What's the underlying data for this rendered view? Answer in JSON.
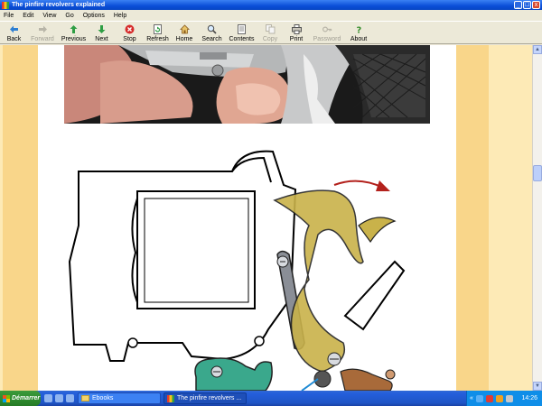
{
  "window": {
    "title": "The pinfire revolvers explained",
    "controls": [
      "_",
      "□",
      "x"
    ]
  },
  "menu": [
    "File",
    "Edit",
    "View",
    "Go",
    "Options",
    "Help"
  ],
  "toolbar": [
    {
      "label": "Back",
      "icon": "back-arrow-icon",
      "enabled": true
    },
    {
      "label": "Forward",
      "icon": "forward-arrow-icon",
      "enabled": false
    },
    {
      "label": "Previous",
      "icon": "up-arrow-icon",
      "enabled": true
    },
    {
      "label": "Next",
      "icon": "down-arrow-icon",
      "enabled": true
    },
    {
      "label": "Stop",
      "icon": "stop-icon",
      "enabled": true
    },
    {
      "label": "Refresh",
      "icon": "refresh-icon",
      "enabled": true
    },
    {
      "label": "Home",
      "icon": "home-icon",
      "enabled": true
    },
    {
      "label": "Search",
      "icon": "search-icon",
      "enabled": true
    },
    {
      "label": "Contents",
      "icon": "contents-icon",
      "enabled": true
    },
    {
      "label": "Copy",
      "icon": "copy-icon",
      "enabled": false
    },
    {
      "label": "Print",
      "icon": "print-icon",
      "enabled": true
    },
    {
      "label": "Password",
      "icon": "key-icon",
      "enabled": false
    },
    {
      "label": "About",
      "icon": "help-icon",
      "enabled": true
    }
  ],
  "colors": {
    "page_margin": "#fdeab6",
    "side_bar": "#f9d68a",
    "hammer": "#c9b24a",
    "trigger_part": "#3aa88c",
    "sear_part": "#a86a3a",
    "arrow": "#b3211c"
  },
  "taskbar": {
    "start_label": "Démarrer",
    "items": [
      {
        "label": "Ebooks",
        "icon": "folder-icon",
        "active": false
      },
      {
        "label": "The pinfire revolvers ...",
        "icon": "browser-icon",
        "active": true
      }
    ],
    "tray_chevron": "«",
    "clock": "14:26"
  }
}
